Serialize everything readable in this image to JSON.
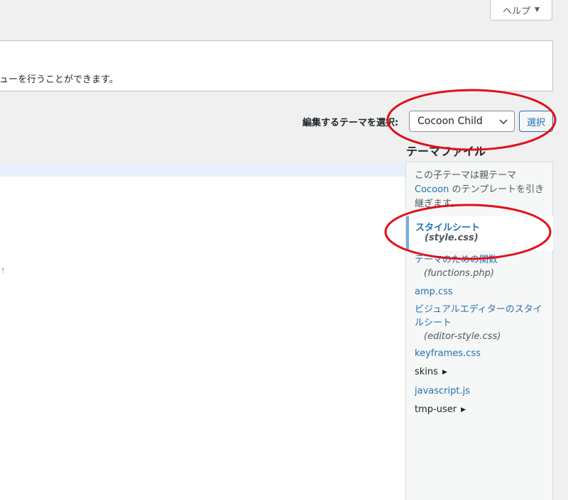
{
  "header": {
    "help_label": "ヘルプ",
    "help_caret": "▼"
  },
  "notice": {
    "text": "ューを行うことができます。"
  },
  "theme_select": {
    "label": "編集するテーマを選択:",
    "value": "Cocoon Child",
    "button_label": "選択"
  },
  "editor": {
    "tick": "↑"
  },
  "theme_files": {
    "heading": "テーマファイル",
    "description_before": "この子テーマは親テーマ ",
    "description_link": "Cocoon",
    "description_after": " のテンプレートを引き継ぎます。",
    "active": {
      "name": "スタイルシート",
      "file": "(style.css)"
    },
    "items": [
      {
        "name": "テーマのための関数",
        "file": "(functions.php)"
      },
      {
        "name": "amp.css",
        "file": ""
      },
      {
        "name": "ビジュアルエディターのスタイルシート",
        "file": "(editor-style.css)"
      },
      {
        "name": "keyframes.css",
        "file": ""
      }
    ],
    "folder_skins": "skins",
    "item_javascript": "javascript.js",
    "folder_tmp_user": "tmp-user",
    "folder_caret": "▶"
  },
  "colors": {
    "link": "#2271b1",
    "annotation_red": "#e0101a",
    "active_border": "#72aee6"
  }
}
